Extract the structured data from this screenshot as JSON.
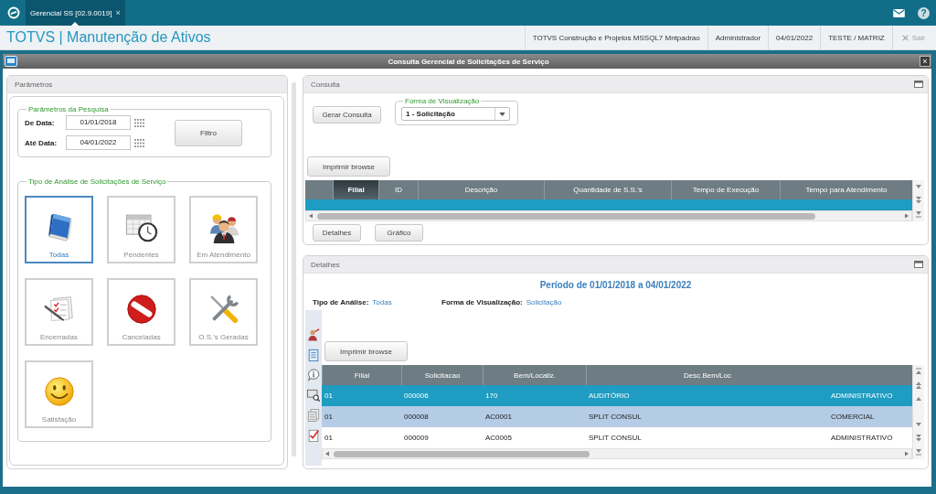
{
  "top_bar": {
    "tab": {
      "label": "Gerencial SS [02.9.0019]",
      "close": "×",
      "selected": true
    },
    "help": "?"
  },
  "header": {
    "app_title": "TOTVS | Manutenção de Ativos",
    "info": [
      "TOTVS Construção e Projetos MSSQL7 Mntpadrao",
      "Administrador",
      "04/01/2022",
      "TESTE / MATRIZ"
    ],
    "exit": {
      "label": "Sair",
      "disabled": true
    }
  },
  "window": {
    "title": "Consulta Gerencial de Solicitações de Serviço",
    "close": "×"
  },
  "parameters": {
    "title": "Parâmetros",
    "search": {
      "legend": "Parâmetros da Pesquisa",
      "fields": [
        {
          "label": "De Data:",
          "value": "01/01/2018"
        },
        {
          "label": "Até Data:",
          "value": "04/01/2022"
        }
      ],
      "filter_button": "Filtro"
    },
    "analysis": {
      "legend": "Tipo de Análise de Solicitações de Serviço",
      "options": [
        {
          "label": "Todas",
          "kind": "book",
          "selected": true
        },
        {
          "label": "Pendentes",
          "kind": "calendar",
          "selected": false
        },
        {
          "label": "Em Atendimento",
          "kind": "people",
          "selected": false
        },
        {
          "label": "Encerradas",
          "kind": "checklist",
          "selected": false
        },
        {
          "label": "Canceladas",
          "kind": "forbidden",
          "selected": false
        },
        {
          "label": "O.S.'s Geradas",
          "kind": "tools",
          "selected": false
        },
        {
          "label": "Satisfação",
          "kind": "smiley",
          "selected": false
        }
      ]
    }
  },
  "consulta": {
    "title": "Consulta",
    "generate_button": "Gerar Consulta",
    "view": {
      "legend": "Forma de Visualização",
      "value": "1 - Solicitação"
    },
    "print_button": "Imprimir browse",
    "table": {
      "columns": [
        {
          "label": "Filial",
          "active": true
        },
        {
          "label": "ID",
          "active": false
        },
        {
          "label": "Descrição",
          "active": false
        },
        {
          "label": "Quantidade de S.S.'s",
          "active": false
        },
        {
          "label": "Tempo de Execução",
          "active": false
        },
        {
          "label": "Tempo para Atendimento",
          "active": false
        }
      ]
    },
    "buttons": [
      "Detalhes",
      "Gráfico"
    ]
  },
  "detalhes": {
    "title": "Detalhes",
    "period": "Período de 01/01/2018 a 04/01/2022",
    "summary": [
      {
        "label": "Tipo de Análise:",
        "value": "Todas"
      },
      {
        "label": "Forma de Visualização:",
        "value": "Solicitação"
      }
    ],
    "print_button": "Imprimir browse",
    "table": {
      "columns": [
        "Filial",
        "Solicitacao",
        "Bem/Localiz.",
        "Desc.Bem/Loc"
      ],
      "rows": [
        {
          "cells": [
            "01",
            "000006",
            "170",
            "AUDITÓRIO",
            "ADMINISTRATIVO"
          ],
          "selected": true
        },
        {
          "cells": [
            "01",
            "000008",
            "AC0001",
            "SPLIT CONSUL",
            "COMERCIAL"
          ],
          "selected": false
        },
        {
          "cells": [
            "01",
            "000009",
            "AC0005",
            "SPLIT CONSUL",
            "ADMINISTRATIVO"
          ],
          "selected": false
        }
      ]
    }
  }
}
